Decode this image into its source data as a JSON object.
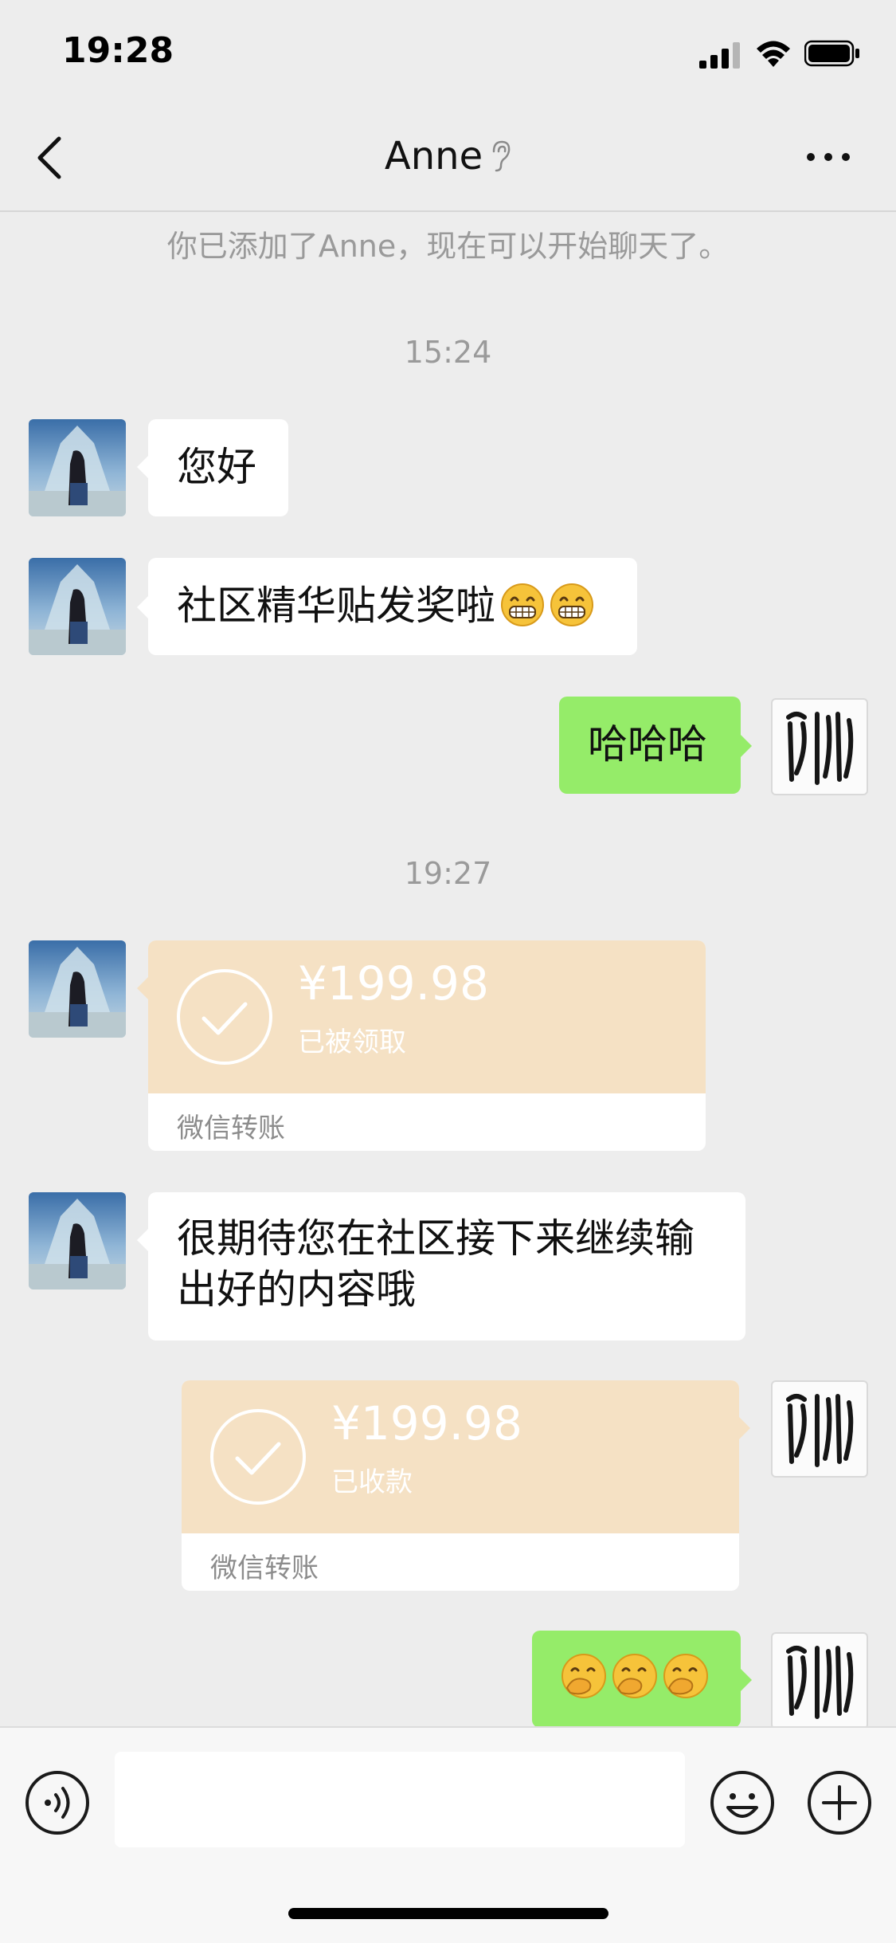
{
  "status_bar": {
    "time": "19:28"
  },
  "nav": {
    "title": "Anne"
  },
  "system_notice": "你已添加了Anne，现在可以开始聊天了。",
  "messages": {
    "t1": "15:24",
    "m1": "您好",
    "m2": "社区精华贴发奖啦",
    "m3": "哈哈哈",
    "t2": "19:27",
    "transfer_in": {
      "amount": "¥199.98",
      "status": "已被领取",
      "footer": "微信转账"
    },
    "m4": "很期待您在社区接下来继续输出好的内容哦",
    "transfer_out": {
      "amount": "¥199.98",
      "status": "已收款",
      "footer": "微信转账"
    }
  },
  "icons": {
    "back": "chevron-left-icon",
    "ear": "ear-icon",
    "more": "more-icon",
    "voice": "voice-icon",
    "emoji": "emoji-icon",
    "plus": "plus-icon",
    "check": "check-circle-icon"
  },
  "colors": {
    "bubble_out": "#95ec69",
    "bubble_in": "#ffffff",
    "transfer_card": "#f5e1c4",
    "background": "#ededed"
  }
}
